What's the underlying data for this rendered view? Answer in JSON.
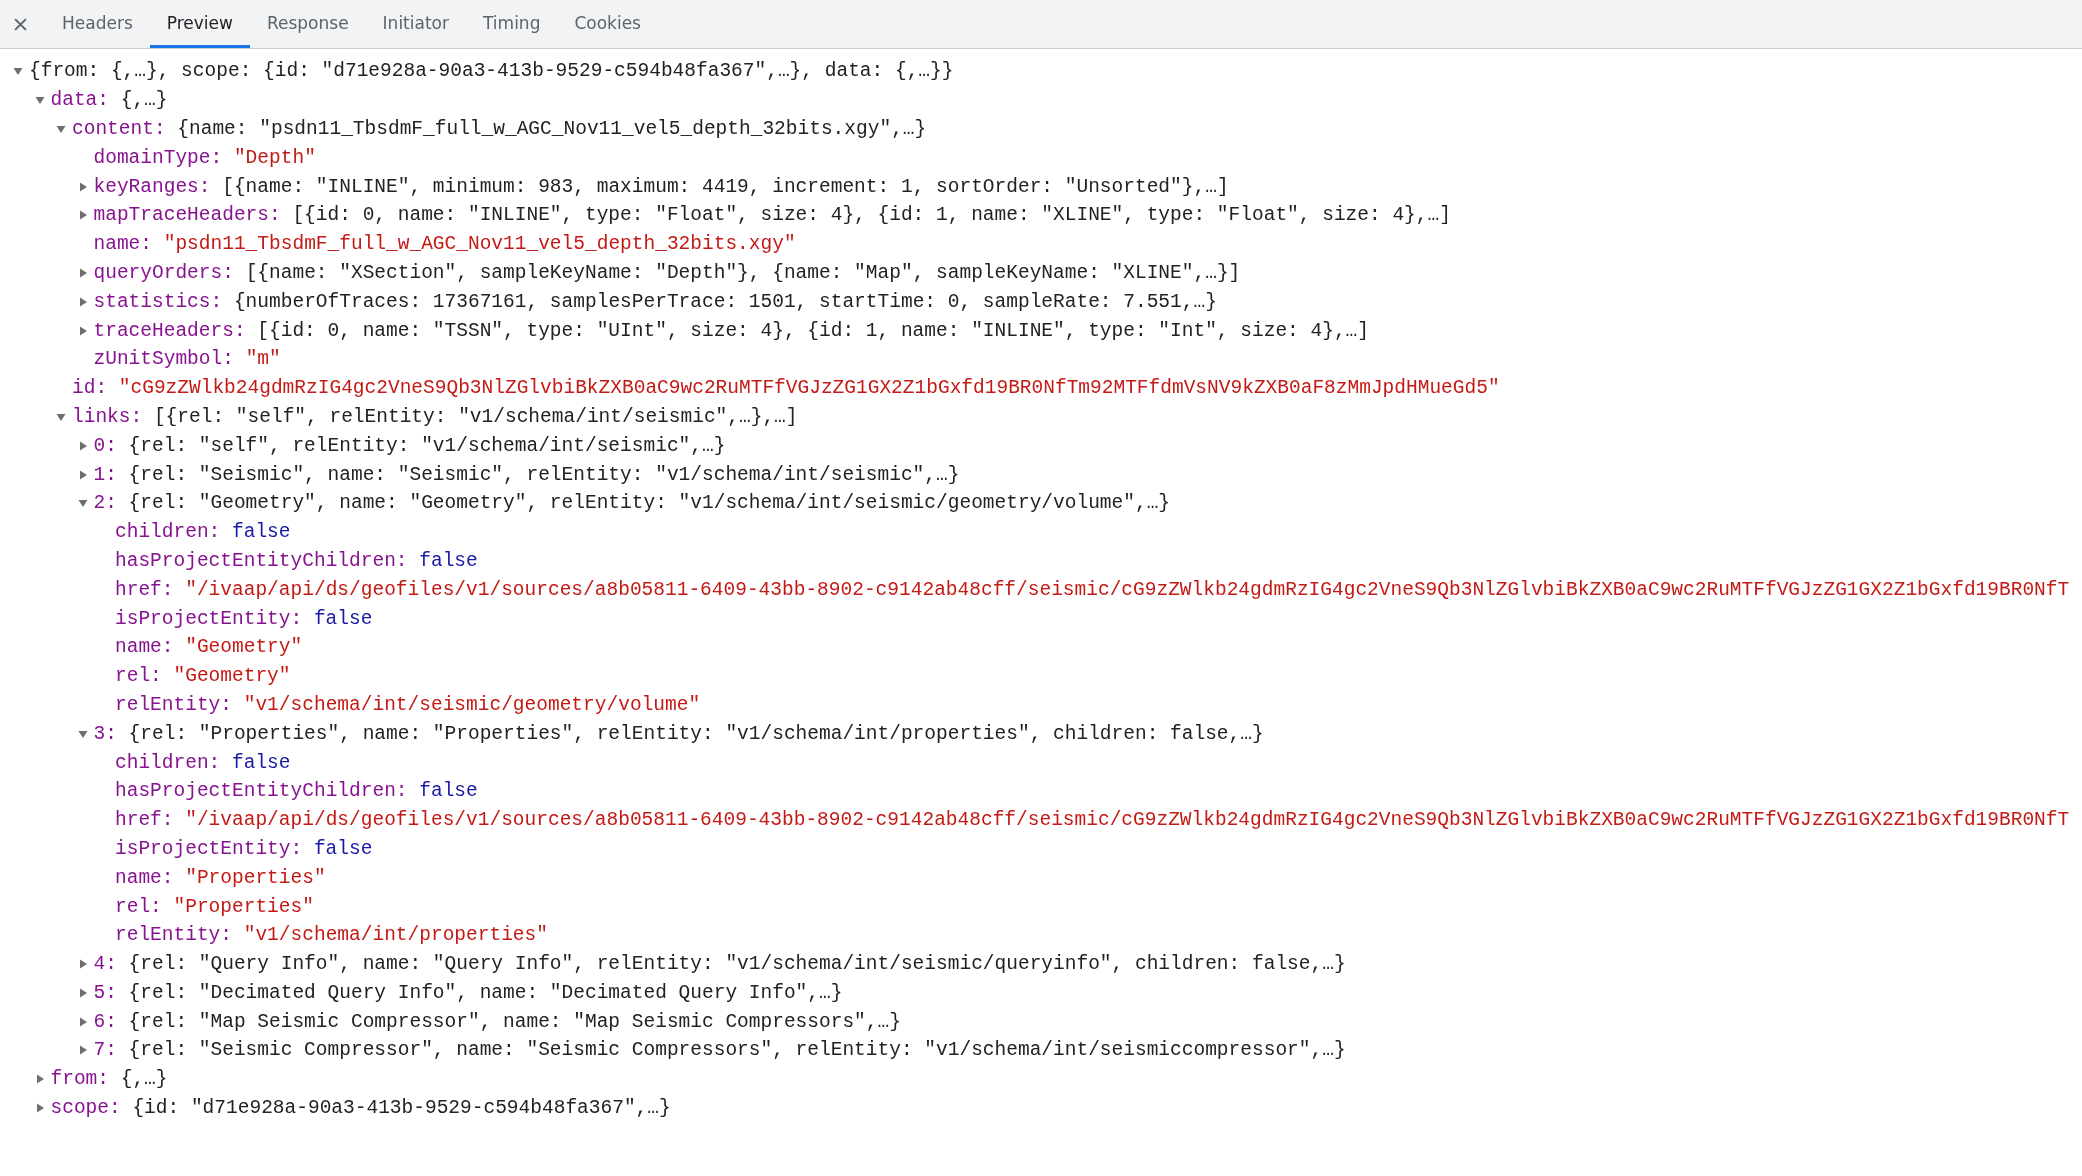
{
  "tabs": [
    {
      "label": "Headers",
      "selected": false
    },
    {
      "label": "Preview",
      "selected": true
    },
    {
      "label": "Response",
      "selected": false
    },
    {
      "label": "Initiator",
      "selected": false
    },
    {
      "label": "Timing",
      "selected": false
    },
    {
      "label": "Cookies",
      "selected": false
    }
  ],
  "tree": [
    {
      "value": "{from: {,…}, scope: {id: \"d71e928a-90a3-413b-9529-c594b48fa367\",…}, data: {,…}}",
      "kind": "summary",
      "expanded": true,
      "children": [
        {
          "key": "data:",
          "value": "{,…}",
          "kind": "summary",
          "expanded": true,
          "children": [
            {
              "key": "content:",
              "value": "{name: \"psdn11_TbsdmF_full_w_AGC_Nov11_vel5_depth_32bits.xgy\",…}",
              "kind": "summary",
              "expanded": true,
              "children": [
                {
                  "key": "domainType:",
                  "value": "\"Depth\"",
                  "kind": "string"
                },
                {
                  "key": "keyRanges:",
                  "value": "[{name: \"INLINE\", minimum: 983, maximum: 4419, increment: 1, sortOrder: \"Unsorted\"},…]",
                  "kind": "summary",
                  "expanded": false
                },
                {
                  "key": "mapTraceHeaders:",
                  "value": "[{id: 0, name: \"INLINE\", type: \"Float\", size: 4}, {id: 1, name: \"XLINE\", type: \"Float\", size: 4},…]",
                  "kind": "summary",
                  "expanded": false
                },
                {
                  "key": "name:",
                  "value": "\"psdn11_TbsdmF_full_w_AGC_Nov11_vel5_depth_32bits.xgy\"",
                  "kind": "string"
                },
                {
                  "key": "queryOrders:",
                  "value": "[{name: \"XSection\", sampleKeyName: \"Depth\"}, {name: \"Map\", sampleKeyName: \"XLINE\",…}]",
                  "kind": "summary",
                  "expanded": false
                },
                {
                  "key": "statistics:",
                  "value": "{numberOfTraces: 17367161, samplesPerTrace: 1501, startTime: 0, sampleRate: 7.551,…}",
                  "kind": "summary",
                  "expanded": false
                },
                {
                  "key": "traceHeaders:",
                  "value": "[{id: 0, name: \"TSSN\", type: \"UInt\", size: 4}, {id: 1, name: \"INLINE\", type: \"Int\", size: 4},…]",
                  "kind": "summary",
                  "expanded": false
                },
                {
                  "key": "zUnitSymbol:",
                  "value": "\"m\"",
                  "kind": "string"
                }
              ]
            },
            {
              "key": "id:",
              "value": "\"cG9zZWlkb24gdmRzIG4gc2VneS9Qb3NlZGlvbiBkZXB0aC9wc2RuMTFfVGJzZG1GX2Z1bGxfd19BR0NfTm92MTFfdmVsNV9kZXB0aF8zMmJpdHMueGd5\"",
              "kind": "string"
            },
            {
              "key": "links:",
              "value": "[{rel: \"self\", relEntity: \"v1/schema/int/seismic\",…},…]",
              "kind": "summary",
              "expanded": true,
              "children": [
                {
                  "key": "0:",
                  "value": "{rel: \"self\", relEntity: \"v1/schema/int/seismic\",…}",
                  "kind": "summary",
                  "expanded": false
                },
                {
                  "key": "1:",
                  "value": "{rel: \"Seismic\", name: \"Seismic\", relEntity: \"v1/schema/int/seismic\",…}",
                  "kind": "summary",
                  "expanded": false
                },
                {
                  "key": "2:",
                  "value": "{rel: \"Geometry\", name: \"Geometry\", relEntity: \"v1/schema/int/seismic/geometry/volume\",…}",
                  "kind": "summary",
                  "expanded": true,
                  "children": [
                    {
                      "key": "children:",
                      "value": "false",
                      "kind": "literal"
                    },
                    {
                      "key": "hasProjectEntityChildren:",
                      "value": "false",
                      "kind": "literal"
                    },
                    {
                      "key": "href:",
                      "value": "\"/ivaap/api/ds/geofiles/v1/sources/a8b05811-6409-43bb-8902-c9142ab48cff/seismic/cG9zZWlkb24gdmRzIG4gc2VneS9Qb3NlZGlvbiBkZXB0aC9wc2RuMTFfVGJzZG1GX2Z1bGxfd19BR0NfT",
                      "kind": "string"
                    },
                    {
                      "key": "isProjectEntity:",
                      "value": "false",
                      "kind": "literal"
                    },
                    {
                      "key": "name:",
                      "value": "\"Geometry\"",
                      "kind": "string"
                    },
                    {
                      "key": "rel:",
                      "value": "\"Geometry\"",
                      "kind": "string"
                    },
                    {
                      "key": "relEntity:",
                      "value": "\"v1/schema/int/seismic/geometry/volume\"",
                      "kind": "string"
                    }
                  ]
                },
                {
                  "key": "3:",
                  "value": "{rel: \"Properties\", name: \"Properties\", relEntity: \"v1/schema/int/properties\", children: false,…}",
                  "kind": "summary",
                  "expanded": true,
                  "children": [
                    {
                      "key": "children:",
                      "value": "false",
                      "kind": "literal"
                    },
                    {
                      "key": "hasProjectEntityChildren:",
                      "value": "false",
                      "kind": "literal"
                    },
                    {
                      "key": "href:",
                      "value": "\"/ivaap/api/ds/geofiles/v1/sources/a8b05811-6409-43bb-8902-c9142ab48cff/seismic/cG9zZWlkb24gdmRzIG4gc2VneS9Qb3NlZGlvbiBkZXB0aC9wc2RuMTFfVGJzZG1GX2Z1bGxfd19BR0NfT",
                      "kind": "string"
                    },
                    {
                      "key": "isProjectEntity:",
                      "value": "false",
                      "kind": "literal"
                    },
                    {
                      "key": "name:",
                      "value": "\"Properties\"",
                      "kind": "string"
                    },
                    {
                      "key": "rel:",
                      "value": "\"Properties\"",
                      "kind": "string"
                    },
                    {
                      "key": "relEntity:",
                      "value": "\"v1/schema/int/properties\"",
                      "kind": "string"
                    }
                  ]
                },
                {
                  "key": "4:",
                  "value": "{rel: \"Query Info\", name: \"Query Info\", relEntity: \"v1/schema/int/seismic/queryinfo\", children: false,…}",
                  "kind": "summary",
                  "expanded": false
                },
                {
                  "key": "5:",
                  "value": "{rel: \"Decimated Query Info\", name: \"Decimated Query Info\",…}",
                  "kind": "summary",
                  "expanded": false
                },
                {
                  "key": "6:",
                  "value": "{rel: \"Map Seismic Compressor\", name: \"Map Seismic Compressors\",…}",
                  "kind": "summary",
                  "expanded": false
                },
                {
                  "key": "7:",
                  "value": "{rel: \"Seismic Compressor\", name: \"Seismic Compressors\", relEntity: \"v1/schema/int/seismiccompressor\",…}",
                  "kind": "summary",
                  "expanded": false
                }
              ]
            }
          ]
        },
        {
          "key": "from:",
          "value": "{,…}",
          "kind": "summary",
          "expanded": false
        },
        {
          "key": "scope:",
          "value": "{id: \"d71e928a-90a3-413b-9529-c594b48fa367\",…}",
          "kind": "summary",
          "expanded": false
        }
      ]
    }
  ]
}
